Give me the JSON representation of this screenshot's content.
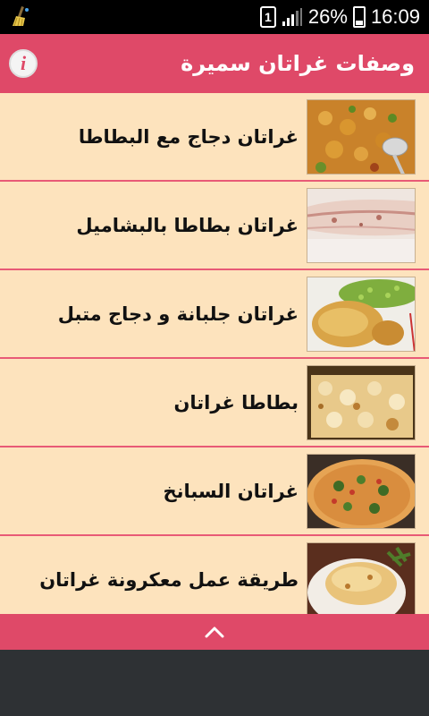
{
  "status_bar": {
    "sim_slot": "1",
    "battery_percent": "26%",
    "battery_level": 0.26,
    "time": "16:09",
    "left_icon": "cleaner-broom-icon"
  },
  "app_bar": {
    "title": "وصفات غراتان سميرة",
    "info_icon_glyph": "i",
    "accent_color": "#df4968"
  },
  "recipes": [
    {
      "title": "غراتان دجاج مع البطاطا",
      "image": "chicken-potato-gratin"
    },
    {
      "title": "غراتان بطاطا بالبشاميل",
      "image": "potato-bechamel-gratin"
    },
    {
      "title": "غراتان جلبانة و دجاج متبل",
      "image": "peas-chicken-gratin"
    },
    {
      "title": "بطاطا غراتان",
      "image": "potato-gratin"
    },
    {
      "title": "غراتان السبانخ",
      "image": "spinach-gratin"
    },
    {
      "title": "طريقة عمل معكرونة غراتان",
      "image": "pasta-gratin"
    }
  ],
  "bottom_bar": {
    "icon": "chevron-up-icon"
  }
}
